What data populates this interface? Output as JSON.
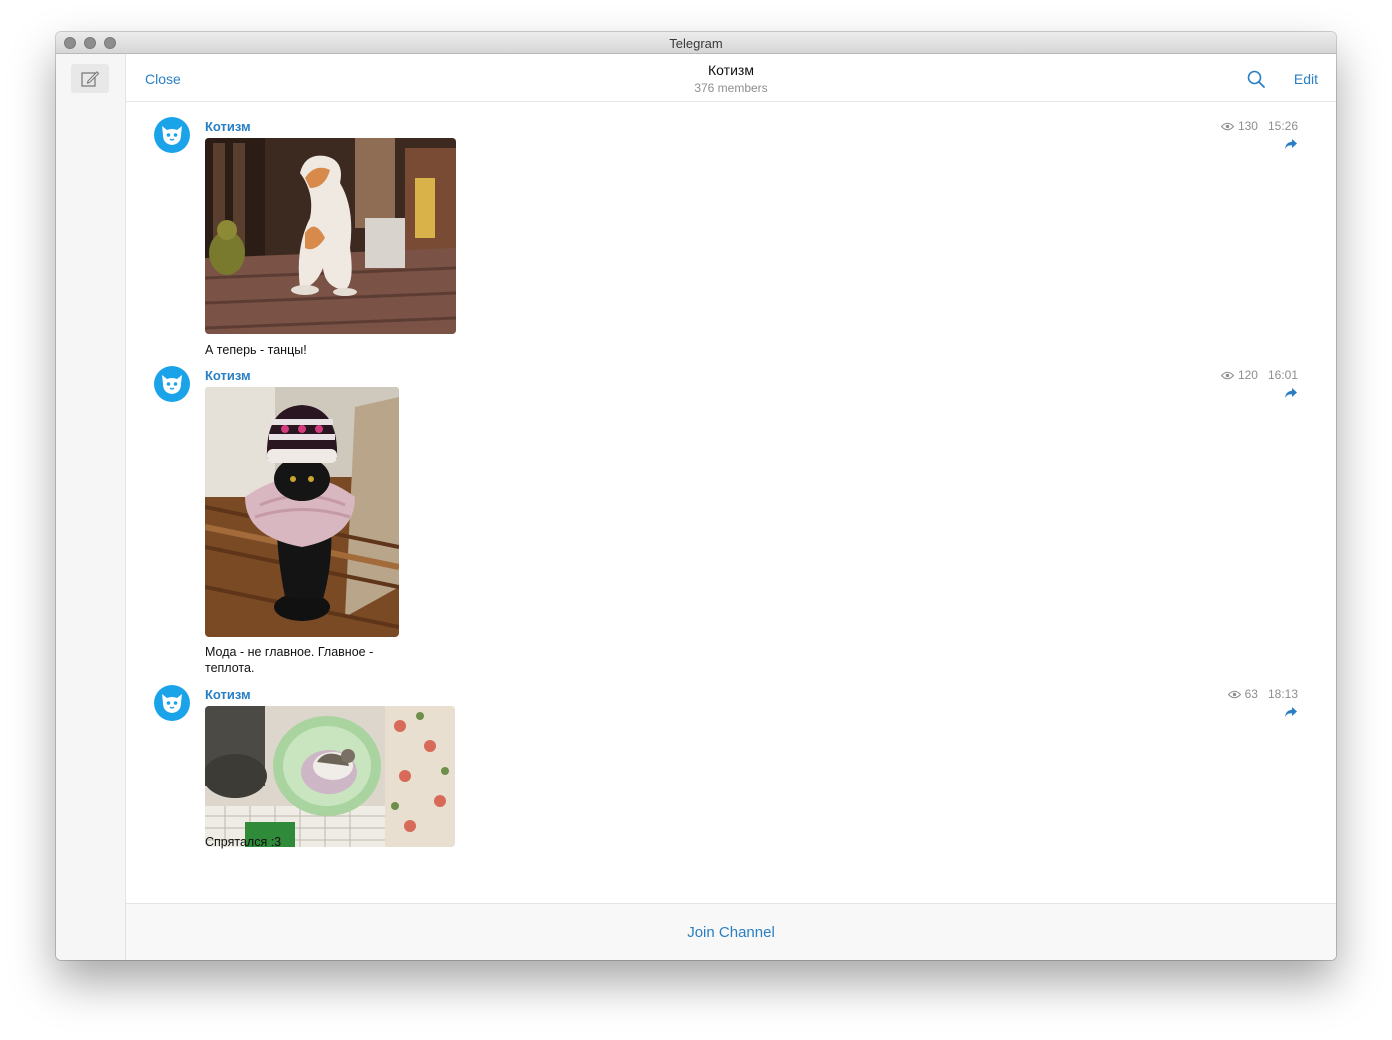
{
  "window": {
    "title": "Telegram"
  },
  "header": {
    "close_label": "Close",
    "chat_title": "Котизм",
    "chat_subtitle": "376 members",
    "edit_label": "Edit"
  },
  "icons": {
    "compose": "compose-icon",
    "search": "search-icon",
    "views": "eye-icon",
    "share": "share-arrow-icon",
    "avatar": "cat-face-icon"
  },
  "colors": {
    "accent": "#2a7fc4",
    "avatar_bg": "#1aa3e8",
    "meta": "#8e8e8e"
  },
  "messages": [
    {
      "author": "Котизм",
      "views": "130",
      "time": "15:26",
      "photo_desc": "white and ginger cat standing on hind legs in a room",
      "caption": "А теперь - танцы!"
    },
    {
      "author": "Котизм",
      "views": "120",
      "time": "16:01",
      "photo_desc": "black cat wearing a knitted hat and pink scarf",
      "caption": "Мода - не главное. Главное - теплота."
    },
    {
      "author": "Котизм",
      "views": "63",
      "time": "18:13",
      "photo_desc": "tabby cat lying in a green plastic bucket",
      "caption": "Спрятался :3"
    }
  ],
  "footer": {
    "join_label": "Join Channel"
  }
}
